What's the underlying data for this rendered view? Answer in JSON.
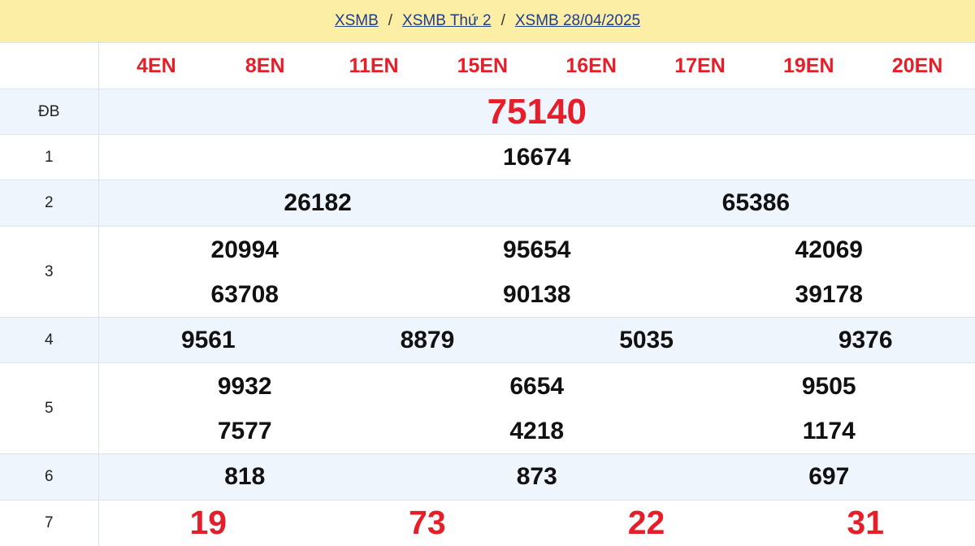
{
  "breadcrumb": {
    "items": [
      "XSMB",
      "XSMB Thứ 2",
      "XSMB 28/04/2025"
    ],
    "separator": "/"
  },
  "codes": [
    "4EN",
    "8EN",
    "11EN",
    "15EN",
    "16EN",
    "17EN",
    "19EN",
    "20EN"
  ],
  "prizes": [
    {
      "label": "ĐB",
      "values": [
        "75140"
      ]
    },
    {
      "label": "1",
      "values": [
        "16674"
      ]
    },
    {
      "label": "2",
      "values": [
        "26182",
        "65386"
      ]
    },
    {
      "label": "3",
      "values": [
        "20994",
        "95654",
        "42069",
        "63708",
        "90138",
        "39178"
      ]
    },
    {
      "label": "4",
      "values": [
        "9561",
        "8879",
        "5035",
        "9376"
      ]
    },
    {
      "label": "5",
      "values": [
        "9932",
        "6654",
        "9505",
        "7577",
        "4218",
        "1174"
      ]
    },
    {
      "label": "6",
      "values": [
        "818",
        "873",
        "697"
      ]
    },
    {
      "label": "7",
      "values": [
        "19",
        "73",
        "22",
        "31"
      ]
    }
  ],
  "colors": {
    "header_bg": "#fdeea6",
    "link": "#1f3e8a",
    "accent_red": "#e61e2a",
    "alt_row": "#eef5fd"
  }
}
